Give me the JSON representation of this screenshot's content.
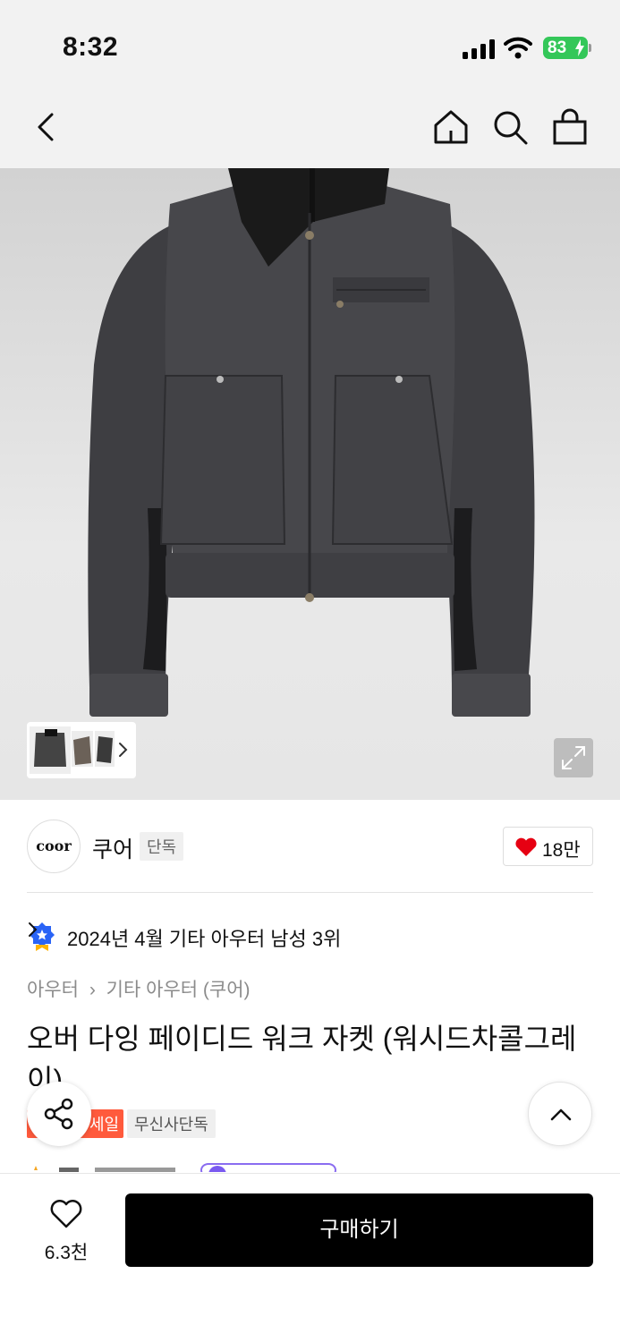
{
  "status_bar": {
    "time": "8:32",
    "battery": "83"
  },
  "nav": {
    "icons": [
      "back-icon",
      "home-icon",
      "search-icon",
      "shopping-bag-icon"
    ]
  },
  "brand": {
    "logo_text": "coor",
    "name": "쿠어",
    "exclusive_tag": "단독",
    "likes": "18만"
  },
  "ranking": {
    "text": "2024년 4월 기타 아우터 남성 3위"
  },
  "breadcrumb": {
    "level1": "아우터",
    "level2": "기타 아우터 (쿠어)"
  },
  "product": {
    "title": "오버 다잉 페이디드 워크 자켓 (워시드차콜그레이)"
  },
  "tags": {
    "sale": "세일",
    "exclusive": "무신사단독"
  },
  "bottom_bar": {
    "wish_count": "6.3천",
    "buy_label": "구매하기"
  },
  "colors": {
    "accent": "#000000",
    "sale": "#ff5a3c",
    "heart": "#e60012",
    "battery": "#34c759",
    "badge": "#2a64f6"
  }
}
